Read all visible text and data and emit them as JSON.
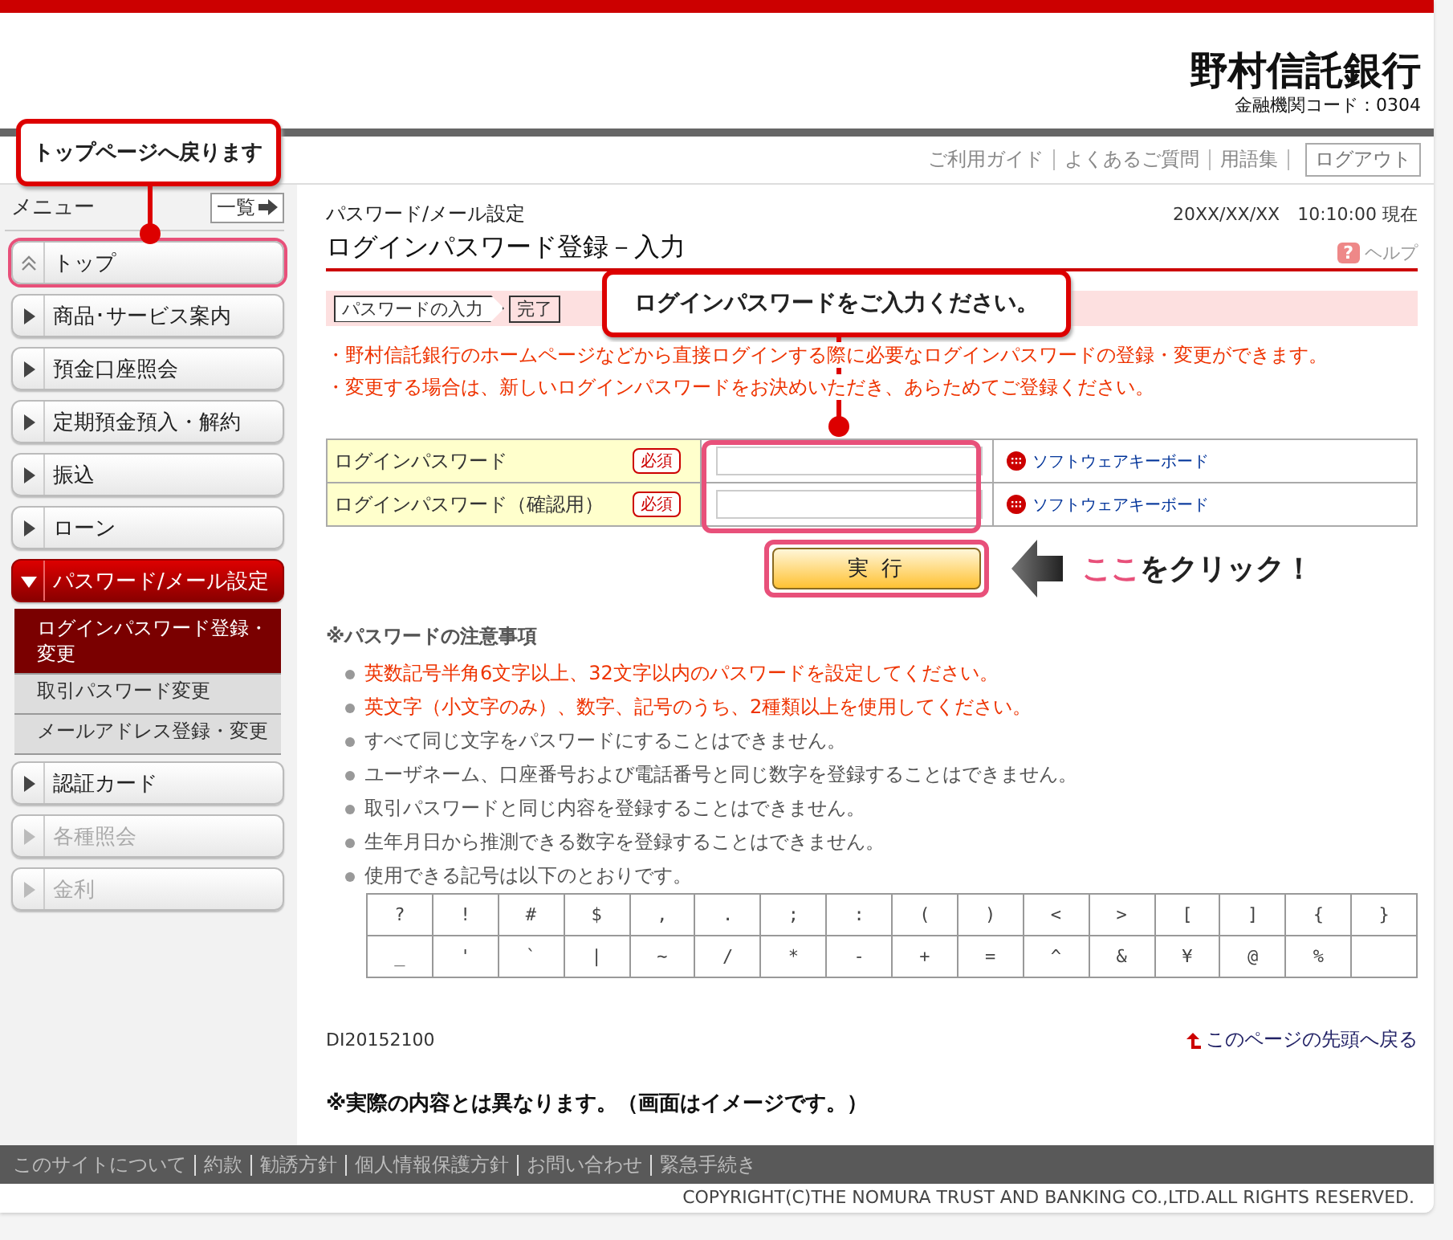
{
  "header": {
    "bank_name": "野村信託銀行",
    "institution_code": "金融機関コード：0304"
  },
  "utility_links": [
    "ご利用ガイド",
    "よくあるご質問",
    "用語集"
  ],
  "logout": "ログアウト",
  "callouts": [
    {
      "kind": "menu",
      "text": "トップページへ戻ります"
    },
    {
      "kind": "form",
      "text": "ログインパスワードをご入力ください。"
    }
  ],
  "click_hint": {
    "highlight": "ここ",
    "text": "をクリック！"
  },
  "sidebar": {
    "title": "メニュー",
    "list_button": "一覧",
    "items": [
      {
        "kind": "top",
        "label": "トップ",
        "expanded": false,
        "disabled": false,
        "highlighted": true
      },
      {
        "kind": "item",
        "label": "商品･サービス案内",
        "expanded": false,
        "disabled": false,
        "highlighted": false
      },
      {
        "kind": "item",
        "label": "預金口座照会",
        "expanded": false,
        "disabled": false,
        "highlighted": false
      },
      {
        "kind": "item",
        "label": "定期預金預入・解約",
        "expanded": false,
        "disabled": false,
        "highlighted": false
      },
      {
        "kind": "item",
        "label": "振込",
        "expanded": false,
        "disabled": false,
        "highlighted": false
      },
      {
        "kind": "item",
        "label": "ローン",
        "expanded": false,
        "disabled": false,
        "highlighted": false
      },
      {
        "kind": "item",
        "label": "パスワード/メール設定",
        "expanded": true,
        "disabled": false,
        "highlighted": false,
        "children": [
          {
            "label": "ログインパスワード登録・変更",
            "selected": true
          },
          {
            "label": "取引パスワード変更",
            "selected": false
          },
          {
            "label": "メールアドレス登録・変更",
            "selected": false
          }
        ]
      },
      {
        "kind": "item",
        "label": "認証カード",
        "expanded": false,
        "disabled": false,
        "highlighted": false
      },
      {
        "kind": "item",
        "label": "各種照会",
        "expanded": false,
        "disabled": true,
        "highlighted": false
      },
      {
        "kind": "item",
        "label": "金利",
        "expanded": false,
        "disabled": true,
        "highlighted": false
      }
    ]
  },
  "main": {
    "breadcrumb": "パスワード/メール設定",
    "datetime": "20XX/XX/XX　10:10:00 現在",
    "title": "ログインパスワード登録－入力",
    "help": {
      "icon": "?",
      "label": "ヘルプ"
    },
    "steps": [
      "パスワードの入力",
      "完了"
    ],
    "notices": [
      "・野村信託銀行のホームページなどから直接ログインする際に必要なログインパスワードの登録・変更ができます。",
      "・変更する場合は、新しいログインパスワードをお決めいただき、あらためてご登録ください。"
    ],
    "form": {
      "highlighted": true,
      "rows": [
        {
          "label": "ログインパスワード",
          "required": "必須",
          "keyboard": "ソフトウェアキーボード"
        },
        {
          "label": "ログインパスワード（確認用）",
          "required": "必須",
          "keyboard": "ソフトウェアキーボード"
        }
      ]
    },
    "submit": {
      "label": "実 行",
      "highlighted": true
    },
    "notes_heading": "※パスワードの注意事項",
    "notes": [
      {
        "text": "英数記号半角6文字以上、32文字以内のパスワードを設定してください。",
        "emphasis": true
      },
      {
        "text": "英文字（小文字のみ）、数字、記号のうち、2種類以上を使用してください。",
        "emphasis": true
      },
      {
        "text": "すべて同じ文字をパスワードにすることはできません。",
        "emphasis": false
      },
      {
        "text": "ユーザネーム、口座番号および電話番号と同じ数字を登録することはできません。",
        "emphasis": false
      },
      {
        "text": "取引パスワードと同じ内容を登録することはできません。",
        "emphasis": false
      },
      {
        "text": "生年月日から推測できる数字を登録することはできません。",
        "emphasis": false
      },
      {
        "text": "使用できる記号は以下のとおりです。",
        "emphasis": false
      }
    ],
    "symbols": [
      [
        "?",
        "!",
        "#",
        "$",
        ",",
        ".",
        ";",
        ":",
        "(",
        ")",
        "<",
        ">",
        "[",
        "]",
        "{",
        "}"
      ],
      [
        "_",
        "'",
        "`",
        "|",
        "~",
        "/",
        "*",
        "-",
        "+",
        "=",
        "^",
        "&",
        "¥",
        "@",
        "%"
      ]
    ],
    "page_code": "DI20152100",
    "back_to_top": "このページの先頭へ戻る",
    "disclaimer": "※実際の内容とは異なります。（画面はイメージです。）"
  },
  "footer": {
    "links": [
      "このサイトについて",
      "約款",
      "勧誘方針",
      "個人情報保護方針",
      "お問い合わせ",
      "緊急手続き"
    ],
    "copyright": "COPYRIGHT(C)THE NOMURA TRUST AND BANKING CO.,LTD.ALL RIGHTS RESERVED."
  }
}
